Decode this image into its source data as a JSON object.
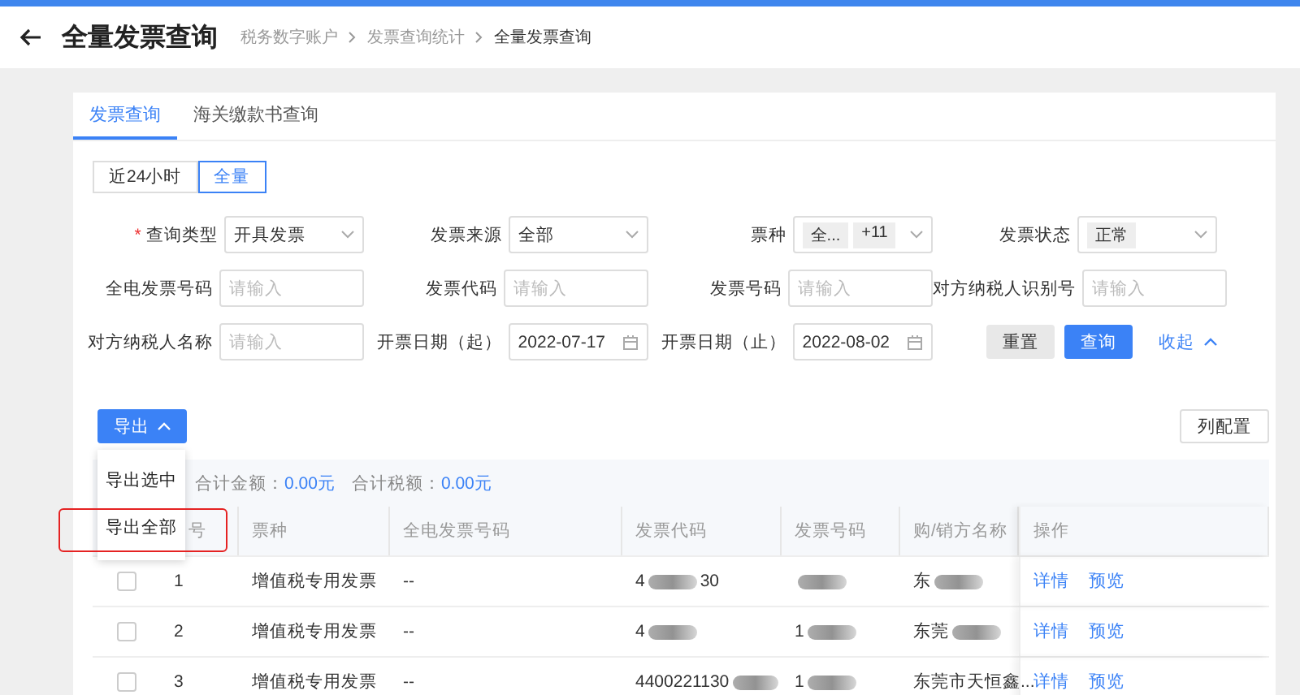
{
  "header": {
    "title": "全量发票查询",
    "breadcrumb": [
      "税务数字账户",
      "发票查询统计",
      "全量发票查询"
    ]
  },
  "tabs": [
    {
      "label": "发票查询",
      "selected": true
    },
    {
      "label": "海关缴款书查询",
      "selected": false
    }
  ],
  "range_toggle": [
    {
      "label": "近24小时",
      "selected": false
    },
    {
      "label": "全量",
      "selected": true
    }
  ],
  "filters": [
    {
      "label": "查询类型",
      "required_mark": "*",
      "kind": "select",
      "value": "开具发票"
    },
    {
      "label": "发票来源",
      "kind": "select",
      "value": "全部"
    },
    {
      "label": "票种",
      "kind": "tags",
      "tags": [
        "全...",
        "+11"
      ]
    },
    {
      "label": "发票状态",
      "kind": "tags",
      "tags": [
        "正常"
      ]
    },
    {
      "label": "全电发票号码",
      "kind": "input",
      "placeholder": "请输入"
    },
    {
      "label": "发票代码",
      "kind": "input",
      "placeholder": "请输入"
    },
    {
      "label": "发票号码",
      "kind": "input",
      "placeholder": "请输入"
    },
    {
      "label": "对方纳税人识别号",
      "kind": "input",
      "placeholder": "请输入"
    },
    {
      "label": "对方纳税人名称",
      "kind": "input",
      "placeholder": "请输入"
    },
    {
      "label": "开票日期（起）",
      "kind": "date",
      "value": "2022-07-17"
    },
    {
      "label": "开票日期（止）",
      "kind": "date",
      "value": "2022-08-02"
    }
  ],
  "actions": {
    "reset": "重置",
    "query": "查询",
    "collapse": "收起"
  },
  "export": {
    "label": "导出",
    "expanded": true,
    "menu": [
      {
        "label": "导出选中",
        "highlighted": false
      },
      {
        "label": "导出全部",
        "highlighted": true
      }
    ]
  },
  "column_config": "列配置",
  "summary": [
    {
      "label": "合计金额：",
      "value": "0.00元"
    },
    {
      "label": "合计税额：",
      "value": "0.00元"
    }
  ],
  "table": {
    "columns": [
      "号",
      "票种",
      "全电发票号码",
      "发票代码",
      "发票号码",
      "购/销方名称",
      "操作"
    ],
    "rows": [
      {
        "checked": false,
        "index": "1",
        "type": "增值税专用发票",
        "full_number": "--",
        "code": "4",
        "code_tail": "30",
        "number": "",
        "party": "东",
        "masked": true,
        "actions": [
          "详情",
          "预览"
        ]
      },
      {
        "checked": false,
        "index": "2",
        "type": "增值税专用发票",
        "full_number": "--",
        "code": "4",
        "code_tail": "",
        "number": "1",
        "party": "东莞",
        "masked": true,
        "actions": [
          "详情",
          "预览"
        ]
      },
      {
        "checked": false,
        "index": "3",
        "type": "增值税专用发票",
        "full_number": "--",
        "code": "4400221130",
        "code_tail": "",
        "number": "1",
        "party": "东莞市天恒鑫...",
        "masked": true,
        "actions": [
          "详情",
          "预览"
        ]
      }
    ]
  }
}
